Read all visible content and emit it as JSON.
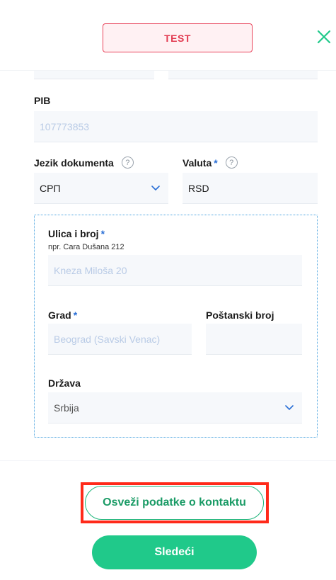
{
  "header": {
    "env_badge": "TEST",
    "close_icon": "close-icon"
  },
  "form": {
    "pib": {
      "label": "PIB",
      "placeholder": "107773853"
    },
    "document_language": {
      "label": "Jezik dokumenta",
      "value": "СРП"
    },
    "currency": {
      "label": "Valuta",
      "required_mark": "*",
      "value": "RSD"
    },
    "help_glyph": "?",
    "address": {
      "street": {
        "label": "Ulica i broj",
        "required_mark": "*",
        "hint": "npr. Cara Dušana 212",
        "placeholder": "Kneza Miloša 20"
      },
      "city": {
        "label": "Grad",
        "required_mark": "*",
        "placeholder": "Beograd (Savski Venac)"
      },
      "postal_code": {
        "label": "Poštanski broj",
        "placeholder": ""
      },
      "country": {
        "label": "Država",
        "value": "Srbija"
      }
    }
  },
  "actions": {
    "refresh_contact_label": "Osveži podatke o kontaktu",
    "next_label": "Sledeći"
  },
  "colors": {
    "accent_green": "#20c98a",
    "badge_red": "#e23a50",
    "highlight_red": "#ff2a1a",
    "required_blue": "#2a6fd6"
  }
}
